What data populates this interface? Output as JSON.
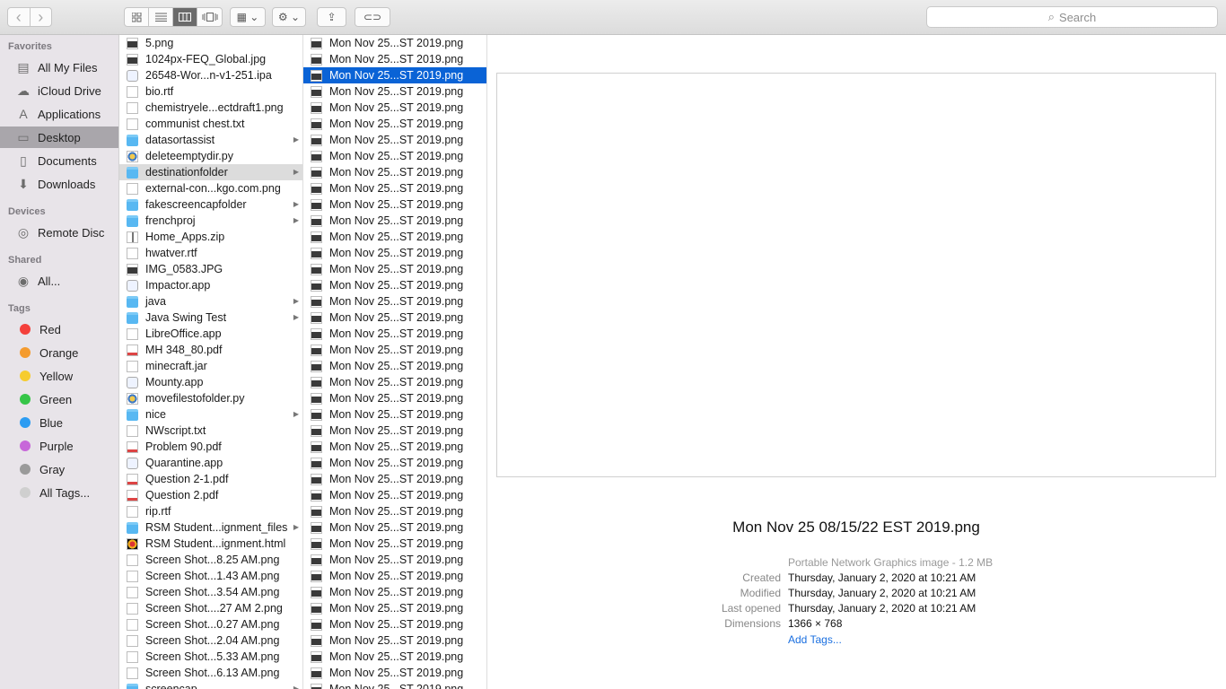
{
  "toolbar": {
    "back_glyph": "‹",
    "forward_glyph": "›",
    "view_icons": [
      "icon-view-icon",
      "list-view-icon",
      "column-view-icon",
      "cover-flow-icon"
    ],
    "arrange_glyph": "▦ ⌄",
    "action_glyph": "⚙ ⌄",
    "share_glyph": "⇪",
    "tag_glyph": "⊂⊃",
    "search_placeholder": "Search",
    "search_glyph": "⌕"
  },
  "sidebar": {
    "favorites_header": "Favorites",
    "favorites": [
      {
        "label": "All My Files",
        "icon": "▤"
      },
      {
        "label": "iCloud Drive",
        "icon": "☁"
      },
      {
        "label": "Applications",
        "icon": "A"
      },
      {
        "label": "Desktop",
        "icon": "▭"
      },
      {
        "label": "Documents",
        "icon": "▯"
      },
      {
        "label": "Downloads",
        "icon": "⬇"
      }
    ],
    "devices_header": "Devices",
    "devices": [
      {
        "label": "Remote Disc",
        "icon": "◎"
      }
    ],
    "shared_header": "Shared",
    "shared": [
      {
        "label": "All...",
        "icon": "◉"
      }
    ],
    "tags_header": "Tags",
    "tags": [
      {
        "label": "Red",
        "color": "#f4403b"
      },
      {
        "label": "Orange",
        "color": "#f49b2e"
      },
      {
        "label": "Yellow",
        "color": "#f6cc2e"
      },
      {
        "label": "Green",
        "color": "#36c548"
      },
      {
        "label": "Blue",
        "color": "#2c9cf2"
      },
      {
        "label": "Purple",
        "color": "#c767d9"
      },
      {
        "label": "Gray",
        "color": "#9a9a9a"
      },
      {
        "label": "All Tags...",
        "color": "#cfcfcf"
      }
    ]
  },
  "column1": [
    {
      "name": "5.png",
      "kind": "img"
    },
    {
      "name": "1024px-FEQ_Global.jpg",
      "kind": "img"
    },
    {
      "name": "26548-Wor...n-v1-251.ipa",
      "kind": "app"
    },
    {
      "name": "bio.rtf",
      "kind": "doc"
    },
    {
      "name": "chemistryele...ectdraft1.png",
      "kind": "doc"
    },
    {
      "name": "communist chest.txt",
      "kind": "doc"
    },
    {
      "name": "datasortassist",
      "kind": "folder",
      "arrow": true
    },
    {
      "name": "deleteemptydir.py",
      "kind": "py"
    },
    {
      "name": "destinationfolder",
      "kind": "folder",
      "arrow": true,
      "selected": true
    },
    {
      "name": "external-con...kgo.com.png",
      "kind": "lock"
    },
    {
      "name": "fakescreencapfolder",
      "kind": "folder",
      "arrow": true
    },
    {
      "name": "frenchproj",
      "kind": "folder",
      "arrow": true
    },
    {
      "name": "Home_Apps.zip",
      "kind": "zip"
    },
    {
      "name": "hwatver.rtf",
      "kind": "doc"
    },
    {
      "name": "IMG_0583.JPG",
      "kind": "img"
    },
    {
      "name": "Impactor.app",
      "kind": "app"
    },
    {
      "name": "java",
      "kind": "folder",
      "arrow": true
    },
    {
      "name": "Java Swing Test",
      "kind": "folder",
      "arrow": true
    },
    {
      "name": "LibreOffice.app",
      "kind": "doc"
    },
    {
      "name": "MH 348_80.pdf",
      "kind": "pdf"
    },
    {
      "name": "minecraft.jar",
      "kind": "doc"
    },
    {
      "name": "Mounty.app",
      "kind": "app"
    },
    {
      "name": "movefilestofolder.py",
      "kind": "py"
    },
    {
      "name": "nice",
      "kind": "folder",
      "arrow": true
    },
    {
      "name": "NWscript.txt",
      "kind": "doc"
    },
    {
      "name": "Problem 90.pdf",
      "kind": "pdf"
    },
    {
      "name": "Quarantine.app",
      "kind": "app"
    },
    {
      "name": "Question 2-1.pdf",
      "kind": "pdf"
    },
    {
      "name": "Question 2.pdf",
      "kind": "pdf"
    },
    {
      "name": "rip.rtf",
      "kind": "doc"
    },
    {
      "name": "RSM Student...ignment_files",
      "kind": "folder",
      "arrow": true
    },
    {
      "name": "RSM Student...ignment.html",
      "kind": "html"
    },
    {
      "name": "Screen Shot...8.25 AM.png",
      "kind": "doc"
    },
    {
      "name": "Screen Shot...1.43 AM.png",
      "kind": "doc"
    },
    {
      "name": "Screen Shot...3.54 AM.png",
      "kind": "doc"
    },
    {
      "name": "Screen Shot....27 AM 2.png",
      "kind": "doc"
    },
    {
      "name": "Screen Shot...0.27 AM.png",
      "kind": "doc"
    },
    {
      "name": "Screen Shot...2.04 AM.png",
      "kind": "doc"
    },
    {
      "name": "Screen Shot...5.33 AM.png",
      "kind": "redx"
    },
    {
      "name": "Screen Shot...6.13 AM.png",
      "kind": "check"
    },
    {
      "name": "screencap",
      "kind": "folder",
      "arrow": true
    }
  ],
  "column2": {
    "item_label": "Mon Nov 25...ST 2019.png",
    "count": 41,
    "selected_index": 2
  },
  "preview": {
    "filename": "Mon Nov 25 08/15/22 EST 2019.png",
    "kind": "Portable Network Graphics image - 1.2 MB",
    "rows": [
      {
        "key": "Created",
        "value": "Thursday, January 2, 2020 at 10:21 AM"
      },
      {
        "key": "Modified",
        "value": "Thursday, January 2, 2020 at 10:21 AM"
      },
      {
        "key": "Last opened",
        "value": "Thursday, January 2, 2020 at 10:21 AM"
      },
      {
        "key": "Dimensions",
        "value": "1366 × 768"
      }
    ],
    "add_tags": "Add Tags..."
  }
}
